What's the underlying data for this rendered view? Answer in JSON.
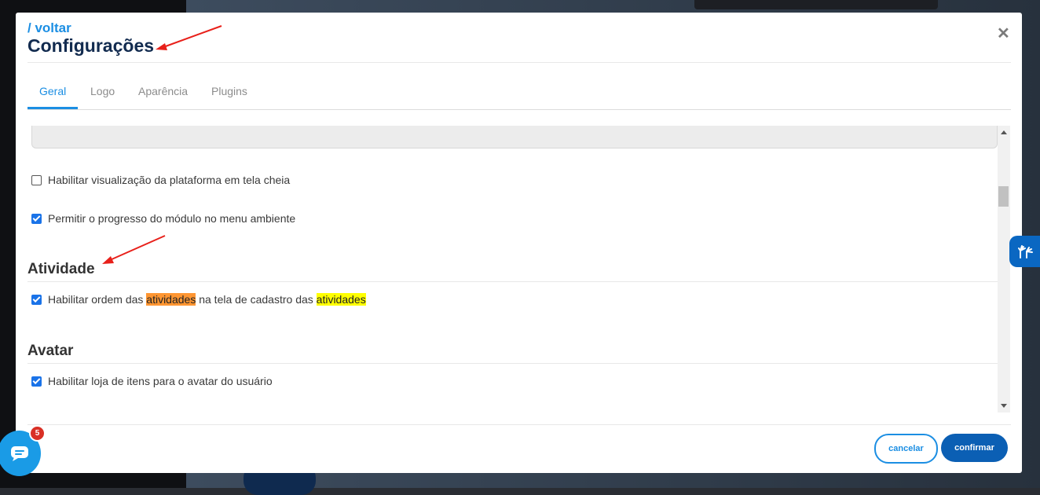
{
  "header": {
    "back_link": "/ voltar",
    "title": "Configurações"
  },
  "tabs": [
    {
      "label": "Geral",
      "active": true
    },
    {
      "label": "Logo",
      "active": false
    },
    {
      "label": "Aparência",
      "active": false
    },
    {
      "label": "Plugins",
      "active": false
    }
  ],
  "options": {
    "fullscreen": {
      "label": "Habilitar visualização da plataforma em tela cheia",
      "checked": false
    },
    "module_progress": {
      "label": "Permitir o progresso do módulo no menu ambiente",
      "checked": true
    }
  },
  "sections": {
    "atividade": {
      "title": "Atividade",
      "option": {
        "text_1": "Habilitar ordem das ",
        "highlight_1": "atividades",
        "text_2": " na tela de cadastro das ",
        "highlight_2": "atividades",
        "checked": true
      }
    },
    "avatar": {
      "title": "Avatar",
      "option": {
        "label": "Habilitar loja de itens para o avatar do usuário",
        "checked": true
      }
    }
  },
  "footer": {
    "cancel_label": "cancelar",
    "confirm_label": "confirmar"
  },
  "chat_widget": {
    "badge_count": "5"
  },
  "colors": {
    "accent": "#1b8ee3",
    "confirm_button": "#0b5fb4",
    "title": "#122b4f",
    "highlight_current": "#ff9632",
    "highlight_match": "#ffff00",
    "annotation_arrow": "#e8201a"
  },
  "icons": [
    "close-icon",
    "sign-language-hands-icon",
    "chat-bubble-icon"
  ]
}
